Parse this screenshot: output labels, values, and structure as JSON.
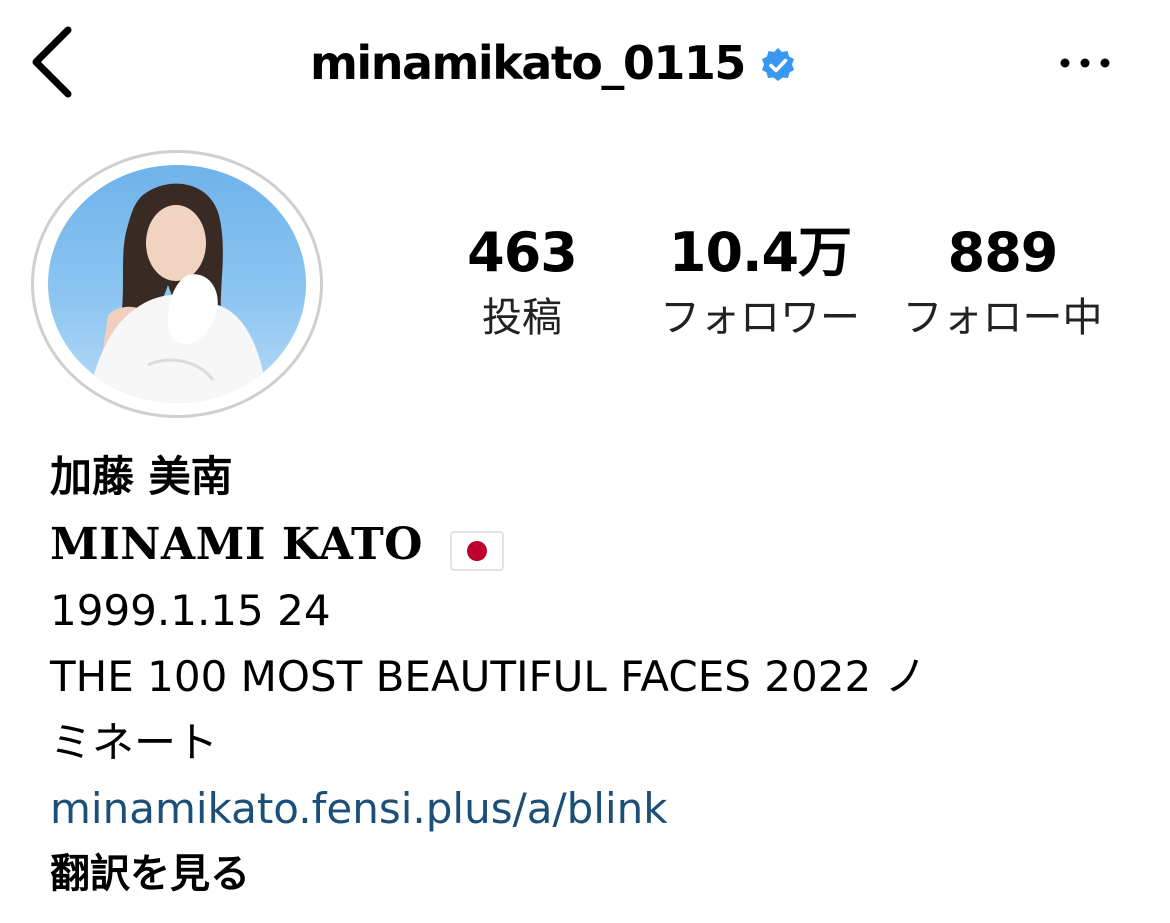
{
  "header": {
    "username": "minamikato_0115",
    "back_icon": "chevron-left-icon",
    "verified_icon": "verified-badge-icon",
    "more_icon": "more-horizontal-icon"
  },
  "stats": {
    "posts": {
      "value": "463",
      "label": "投稿"
    },
    "followers": {
      "value": "10.4万",
      "label": "フォロワー"
    },
    "following": {
      "value": "889",
      "label": "フォロー中"
    }
  },
  "bio": {
    "display_name": "加藤 美南",
    "styled_name": "MINAMI KATO",
    "flag_icon": "japan-flag-icon",
    "birth_line": "1999.1.15 24",
    "award_line_1": "THE 100 MOST BEAUTIFUL FACES 2022 ノ",
    "award_line_2": "ミネート",
    "link": "minamikato.fensi.plus/a/blink",
    "translate_label": "翻訳を見る"
  },
  "colors": {
    "link": "#1c4f78",
    "verified": "#3897f0",
    "avatar_ring": "#cfcfcf",
    "flag_red": "#bc002d"
  }
}
